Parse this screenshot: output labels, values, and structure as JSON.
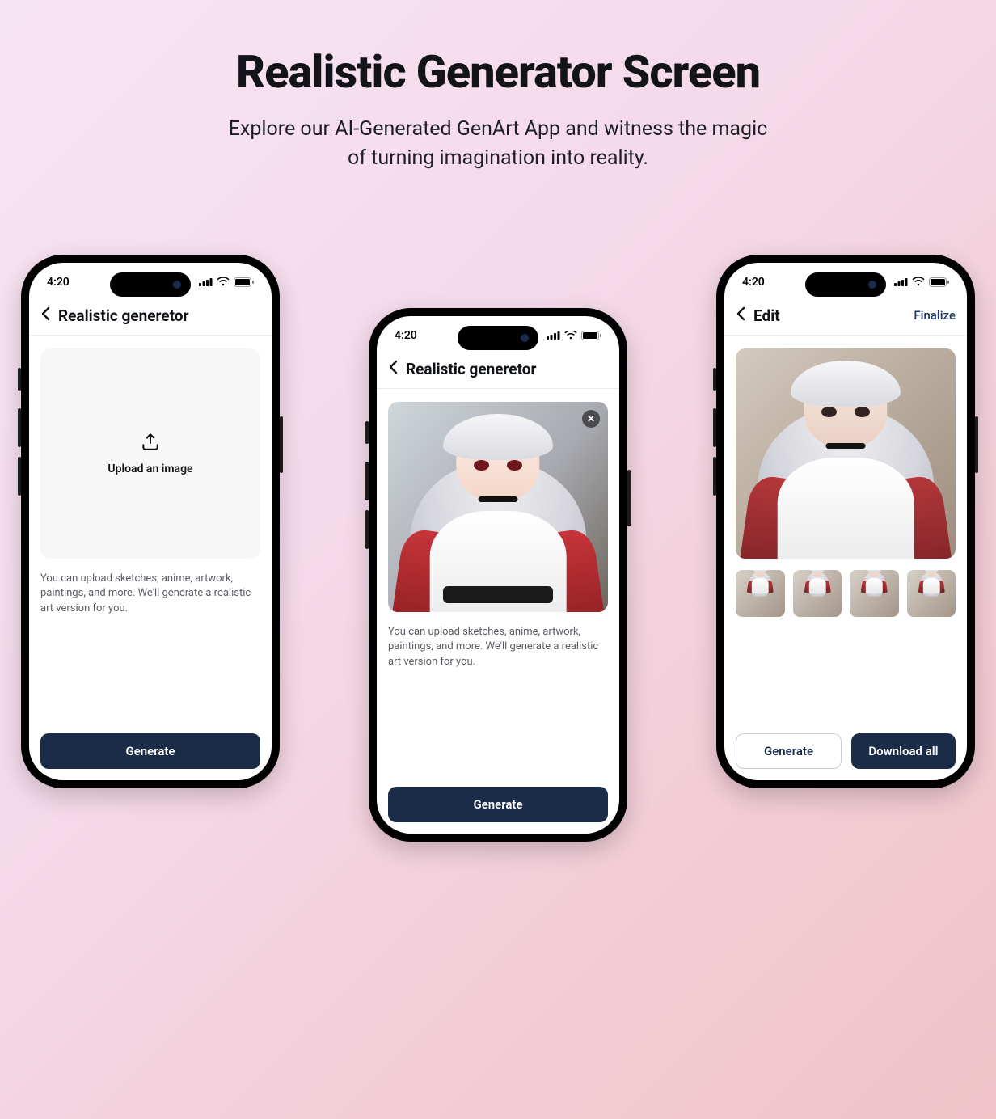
{
  "page": {
    "title": "Realistic Generator Screen",
    "subtitle_line1": "Explore our AI-Generated GenArt App and witness the magic",
    "subtitle_line2": "of turning imagination into reality."
  },
  "status": {
    "time": "4:20"
  },
  "phone1": {
    "screen_title": "Realistic generetor",
    "upload_label": "Upload an image",
    "help_text": "You can upload sketches, anime, artwork, paintings, and more. We'll generate a realistic art version for you.",
    "primary_button": "Generate"
  },
  "phone2": {
    "screen_title": "Realistic generetor",
    "help_text": "You can upload sketches, anime, artwork, paintings, and more. We'll generate a realistic art version for you.",
    "primary_button": "Generate"
  },
  "phone3": {
    "screen_title": "Edit",
    "action": "Finalize",
    "secondary_button": "Generate",
    "primary_button": "Download all"
  }
}
